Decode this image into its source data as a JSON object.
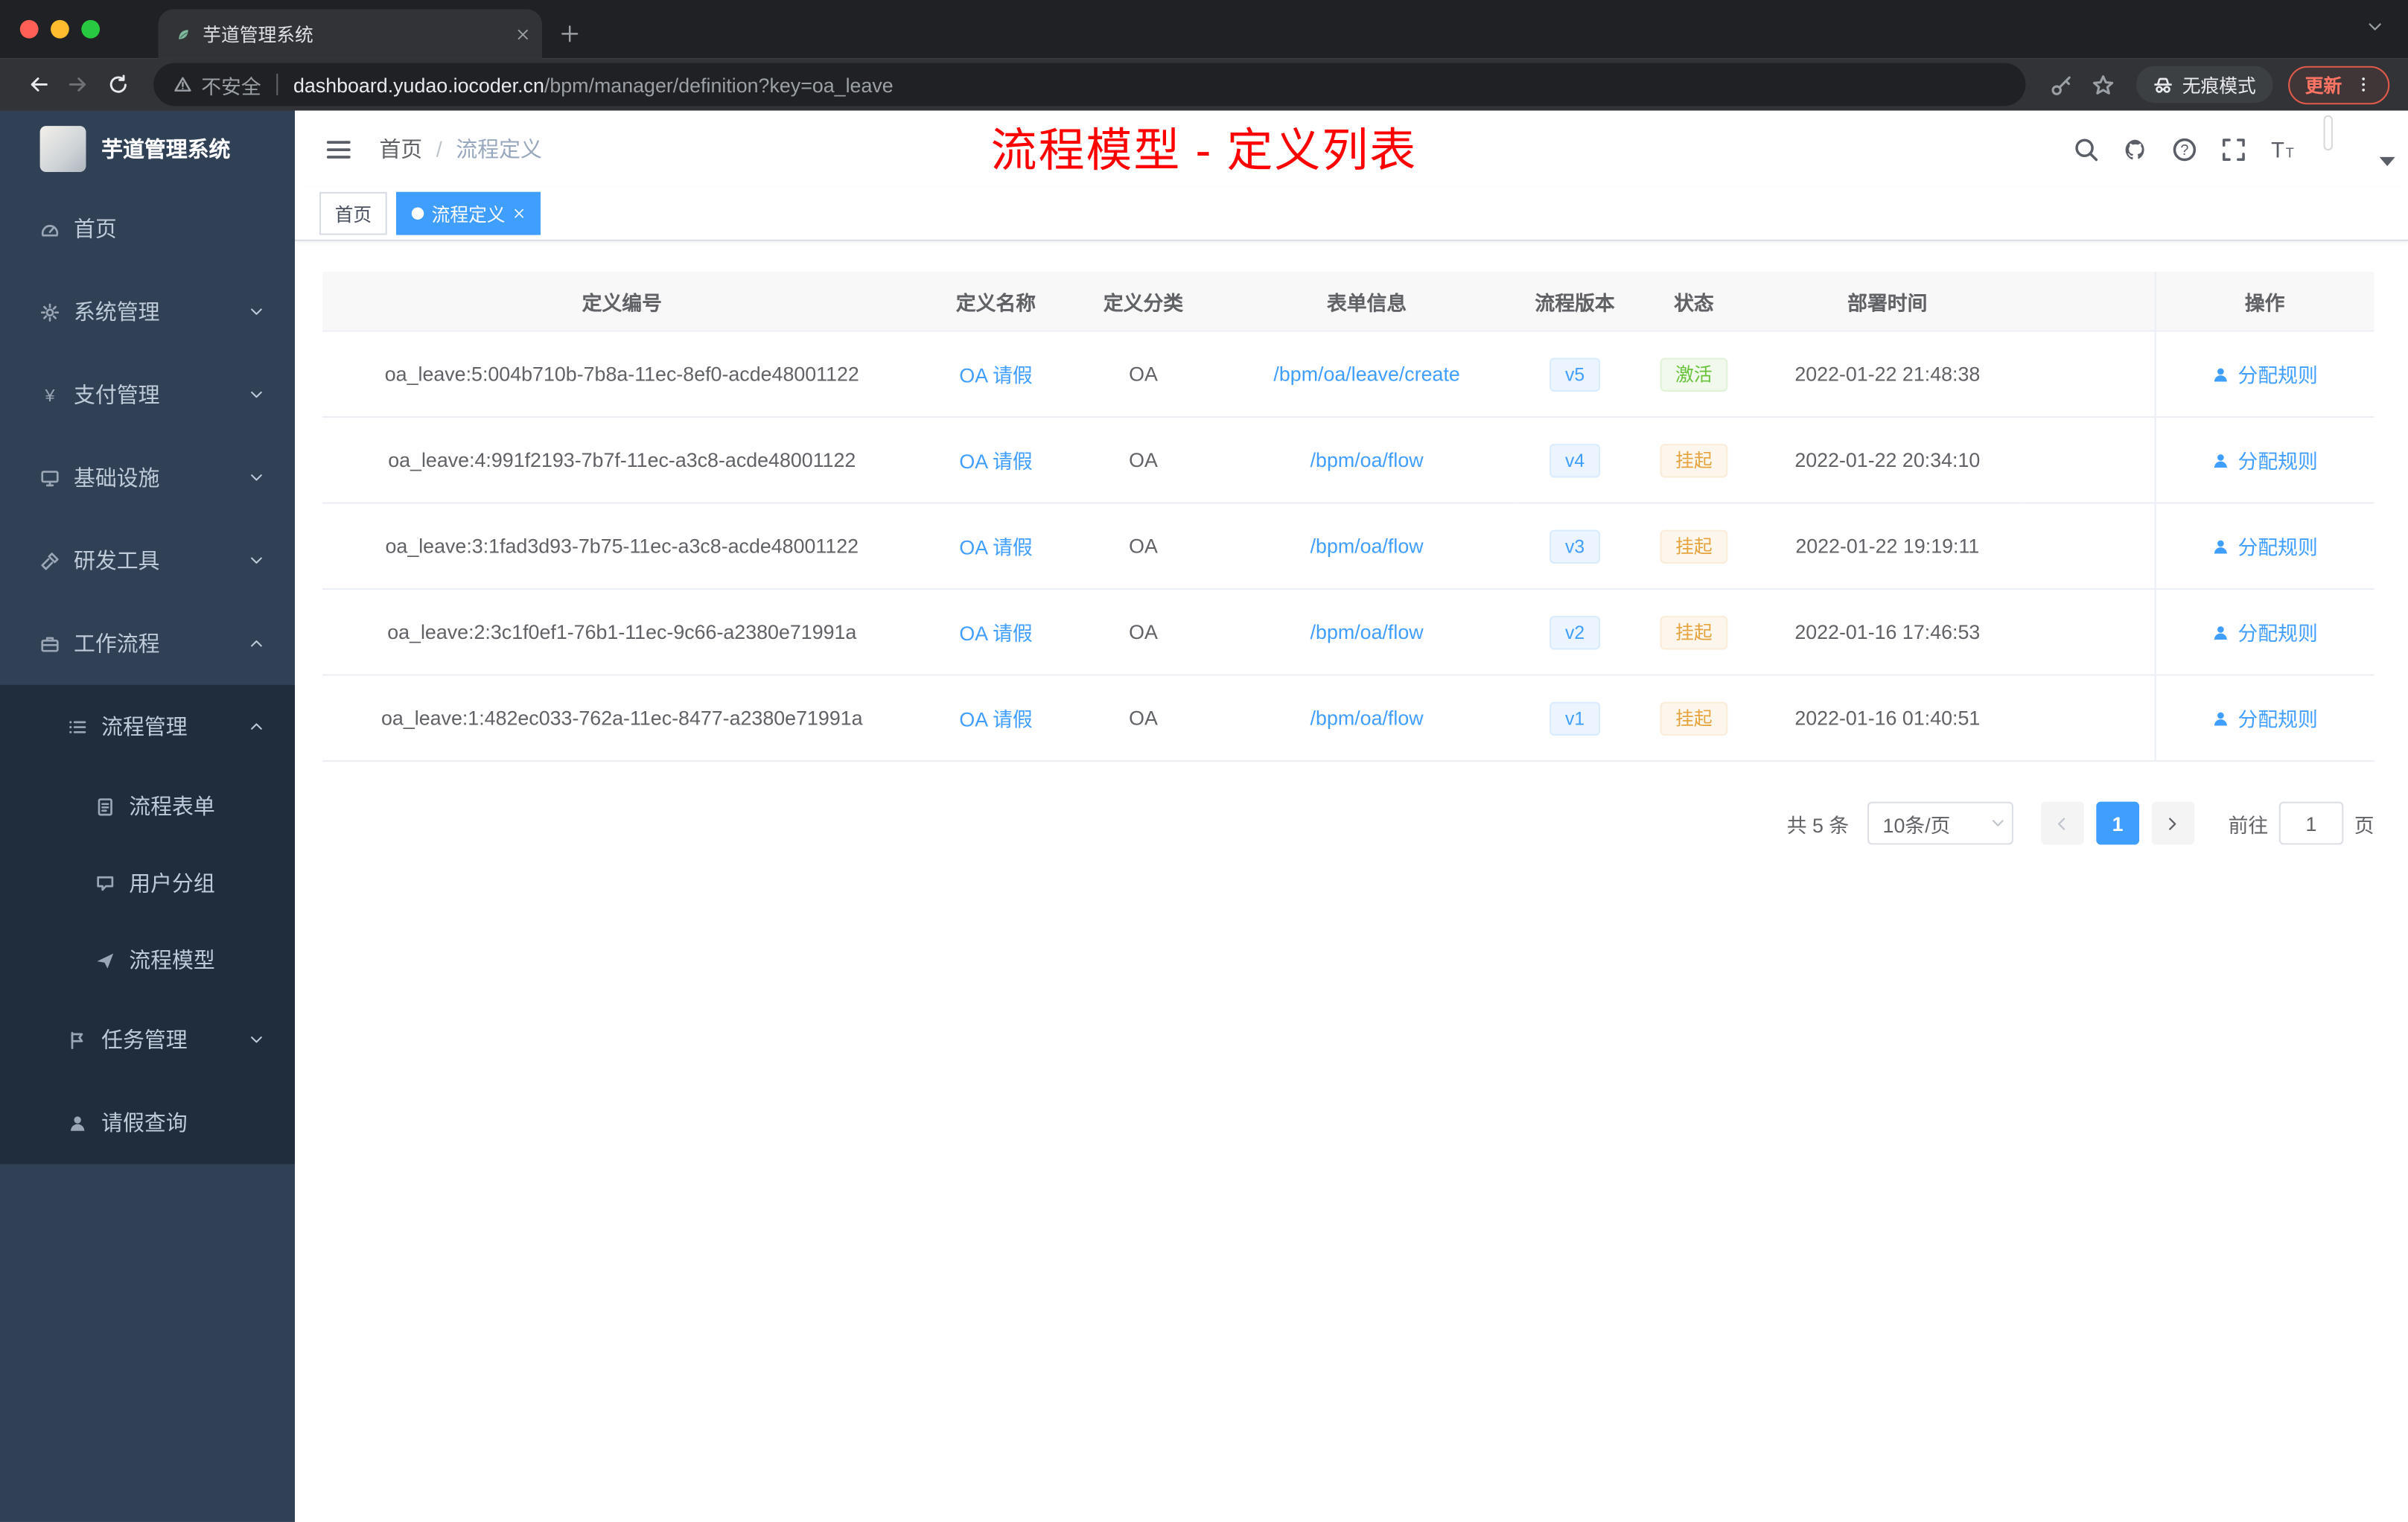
{
  "browser": {
    "tab_title": "芋道管理系统",
    "security_label": "不安全",
    "url_domain": "dashboard.yudao.iocoder.cn",
    "url_path": "/bpm/manager/definition?key=oa_leave",
    "incognito_label": "无痕模式",
    "update_label": "更新"
  },
  "sidebar": {
    "title": "芋道管理系统",
    "items": [
      {
        "label": "首页",
        "icon": "dashboard-icon",
        "level": 1
      },
      {
        "label": "系统管理",
        "icon": "gear-icon",
        "level": 1,
        "arrow": "down"
      },
      {
        "label": "支付管理",
        "icon": "yen-icon",
        "level": 1,
        "arrow": "down"
      },
      {
        "label": "基础设施",
        "icon": "monitor-icon",
        "level": 1,
        "arrow": "down"
      },
      {
        "label": "研发工具",
        "icon": "tools-icon",
        "level": 1,
        "arrow": "down"
      },
      {
        "label": "工作流程",
        "icon": "briefcase-icon",
        "level": 1,
        "arrow": "up"
      },
      {
        "label": "流程管理",
        "icon": "list-icon",
        "level": 2,
        "arrow": "up",
        "in_submenu": true
      },
      {
        "label": "流程表单",
        "icon": "document-icon",
        "level": 3,
        "in_submenu": true
      },
      {
        "label": "用户分组",
        "icon": "chat-icon",
        "level": 3,
        "in_submenu": true
      },
      {
        "label": "流程模型",
        "icon": "send-icon",
        "level": 3,
        "in_submenu": true
      },
      {
        "label": "任务管理",
        "icon": "flag-icon",
        "level": 2,
        "arrow": "down",
        "in_submenu": true
      },
      {
        "label": "请假查询",
        "icon": "user-icon",
        "level": 2,
        "in_submenu": true
      }
    ]
  },
  "header": {
    "breadcrumb": {
      "home": "首页",
      "separator": "/",
      "current": "流程定义"
    },
    "annotation": "流程模型 - 定义列表"
  },
  "tags": [
    {
      "label": "首页",
      "active": false,
      "closable": false
    },
    {
      "label": "流程定义",
      "active": true,
      "closable": true
    }
  ],
  "table": {
    "columns": [
      "定义编号",
      "定义名称",
      "定义分类",
      "表单信息",
      "流程版本",
      "状态",
      "部署时间",
      "操作"
    ],
    "rows": [
      {
        "id": "oa_leave:5:004b710b-7b8a-11ec-8ef0-acde48001122",
        "name": "OA 请假",
        "category": "OA",
        "form": "/bpm/oa/leave/create",
        "version": "v5",
        "status": "激活",
        "status_type": "success",
        "deploy_time": "2022-01-22 21:48:38",
        "action": "分配规则"
      },
      {
        "id": "oa_leave:4:991f2193-7b7f-11ec-a3c8-acde48001122",
        "name": "OA 请假",
        "category": "OA",
        "form": "/bpm/oa/flow",
        "version": "v4",
        "status": "挂起",
        "status_type": "warning",
        "deploy_time": "2022-01-22 20:34:10",
        "action": "分配规则"
      },
      {
        "id": "oa_leave:3:1fad3d93-7b75-11ec-a3c8-acde48001122",
        "name": "OA 请假",
        "category": "OA",
        "form": "/bpm/oa/flow",
        "version": "v3",
        "status": "挂起",
        "status_type": "warning",
        "deploy_time": "2022-01-22 19:19:11",
        "action": "分配规则"
      },
      {
        "id": "oa_leave:2:3c1f0ef1-76b1-11ec-9c66-a2380e71991a",
        "name": "OA 请假",
        "category": "OA",
        "form": "/bpm/oa/flow",
        "version": "v2",
        "status": "挂起",
        "status_type": "warning",
        "deploy_time": "2022-01-16 17:46:53",
        "action": "分配规则"
      },
      {
        "id": "oa_leave:1:482ec033-762a-11ec-8477-a2380e71991a",
        "name": "OA 请假",
        "category": "OA",
        "form": "/bpm/oa/flow",
        "version": "v1",
        "status": "挂起",
        "status_type": "warning",
        "deploy_time": "2022-01-16 01:40:51",
        "action": "分配规则"
      }
    ]
  },
  "pagination": {
    "total": "共 5 条",
    "page_size": "10条/页",
    "current_page": "1",
    "goto_label": "前往",
    "goto_value": "1",
    "page_unit": "页"
  },
  "colors": {
    "accent_blue": "#409eff",
    "success_green": "#67c23a",
    "warning_orange": "#e6a23c",
    "annotation_red": "#ff0000",
    "sidebar_bg": "#304156",
    "submenu_bg": "#1f2d3d"
  }
}
